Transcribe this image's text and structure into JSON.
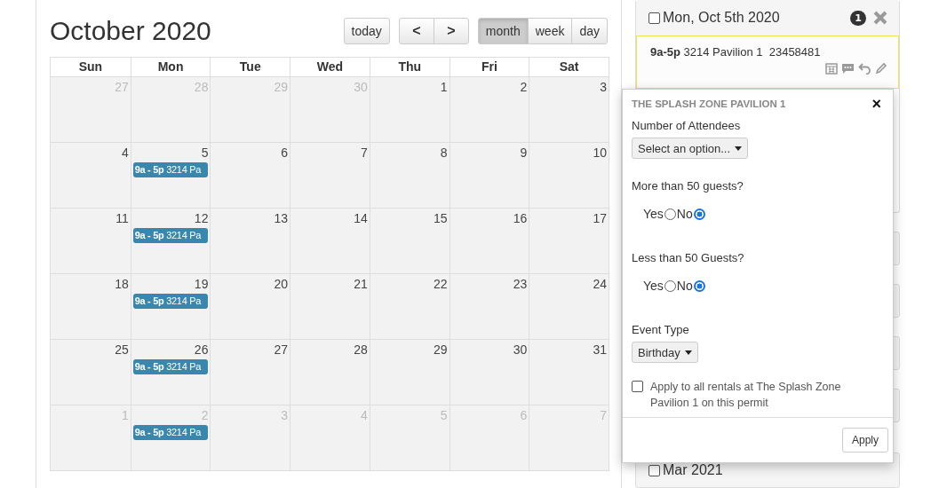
{
  "calendar": {
    "title": "October 2020",
    "buttons": [
      {
        "label": "today",
        "kind": "text"
      },
      {
        "label": "<",
        "kind": "prev"
      },
      {
        "label": ">",
        "kind": "next"
      }
    ],
    "views": [
      {
        "label": "month",
        "selected": true
      },
      {
        "label": "week",
        "selected": false
      },
      {
        "label": "day",
        "selected": false
      }
    ],
    "weekdays": [
      "Sun",
      "Mon",
      "Tue",
      "Wed",
      "Thu",
      "Fri",
      "Sat"
    ],
    "weeks": [
      [
        {
          "day": "27",
          "other_month": true
        },
        {
          "day": "28",
          "other_month": true
        },
        {
          "day": "29",
          "other_month": true
        },
        {
          "day": "30",
          "other_month": true
        },
        {
          "day": "1",
          "other_month": false
        },
        {
          "day": "2",
          "other_month": false
        },
        {
          "day": "3",
          "other_month": false
        }
      ],
      [
        {
          "day": "4",
          "other_month": false
        },
        {
          "day": "5",
          "other_month": false,
          "events": [
            {
              "time": "9a - 5p",
              "title": "3214 Pa"
            }
          ]
        },
        {
          "day": "6",
          "other_month": false
        },
        {
          "day": "7",
          "other_month": false
        },
        {
          "day": "8",
          "other_month": false
        },
        {
          "day": "9",
          "other_month": false
        },
        {
          "day": "10",
          "other_month": false
        }
      ],
      [
        {
          "day": "11",
          "other_month": false
        },
        {
          "day": "12",
          "other_month": false,
          "events": [
            {
              "time": "9a - 5p",
              "title": "3214 Pa"
            }
          ]
        },
        {
          "day": "13",
          "other_month": false
        },
        {
          "day": "14",
          "other_month": false
        },
        {
          "day": "15",
          "other_month": false
        },
        {
          "day": "16",
          "other_month": false
        },
        {
          "day": "17",
          "other_month": false
        }
      ],
      [
        {
          "day": "18",
          "other_month": false
        },
        {
          "day": "19",
          "other_month": false,
          "events": [
            {
              "time": "9a - 5p",
              "title": "3214 Pa"
            }
          ]
        },
        {
          "day": "20",
          "other_month": false
        },
        {
          "day": "21",
          "other_month": false
        },
        {
          "day": "22",
          "other_month": false
        },
        {
          "day": "23",
          "other_month": false
        },
        {
          "day": "24",
          "other_month": false
        }
      ],
      [
        {
          "day": "25",
          "other_month": false
        },
        {
          "day": "26",
          "other_month": false,
          "events": [
            {
              "time": "9a - 5p",
              "title": "3214 Pa"
            }
          ]
        },
        {
          "day": "27",
          "other_month": false
        },
        {
          "day": "28",
          "other_month": false
        },
        {
          "day": "29",
          "other_month": false
        },
        {
          "day": "30",
          "other_month": false
        },
        {
          "day": "31",
          "other_month": false
        }
      ],
      [
        {
          "day": "1",
          "other_month": true
        },
        {
          "day": "2",
          "other_month": true,
          "events": [
            {
              "time": "9a - 5p",
              "title": "3214 Pa"
            }
          ]
        },
        {
          "day": "3",
          "other_month": true
        },
        {
          "day": "4",
          "other_month": true
        },
        {
          "day": "5",
          "other_month": true
        },
        {
          "day": "6",
          "other_month": true
        },
        {
          "day": "7",
          "other_month": true
        }
      ]
    ]
  },
  "sidebar": {
    "cards": [
      {
        "kind": "expanded",
        "title": "Mon, Oct 5th 2020",
        "checked": false,
        "badge": "1",
        "rental": {
          "time": "9a-5p",
          "name": "3214 Pavilion 1",
          "number": "23458481"
        }
      },
      {
        "kind": "hidden"
      },
      {
        "kind": "hidden"
      },
      {
        "kind": "hidden"
      },
      {
        "kind": "hidden"
      },
      {
        "kind": "collapsed",
        "title": "Mar 2021",
        "checked": false
      }
    ]
  },
  "popover": {
    "title": "THE SPLASH ZONE PAVILION 1",
    "close": "×",
    "fields": [
      {
        "kind": "select",
        "label": "Number of Attendees",
        "value": "Select an option..."
      },
      {
        "kind": "radio",
        "label": "More than 50 guests?",
        "options": [
          {
            "label": "Yes",
            "selected": false
          },
          {
            "label": "No",
            "selected": true
          }
        ]
      },
      {
        "kind": "radio",
        "label": "Less than 50 Guests?",
        "options": [
          {
            "label": "Yes",
            "selected": false
          },
          {
            "label": "No",
            "selected": true
          }
        ]
      },
      {
        "kind": "select",
        "label": "Event Type",
        "value": "Birthday"
      }
    ],
    "apply_all": {
      "label": "Apply to all rentals at The Splash Zone Pavilion 1 on this permit",
      "checked": false
    },
    "button": "Apply"
  }
}
